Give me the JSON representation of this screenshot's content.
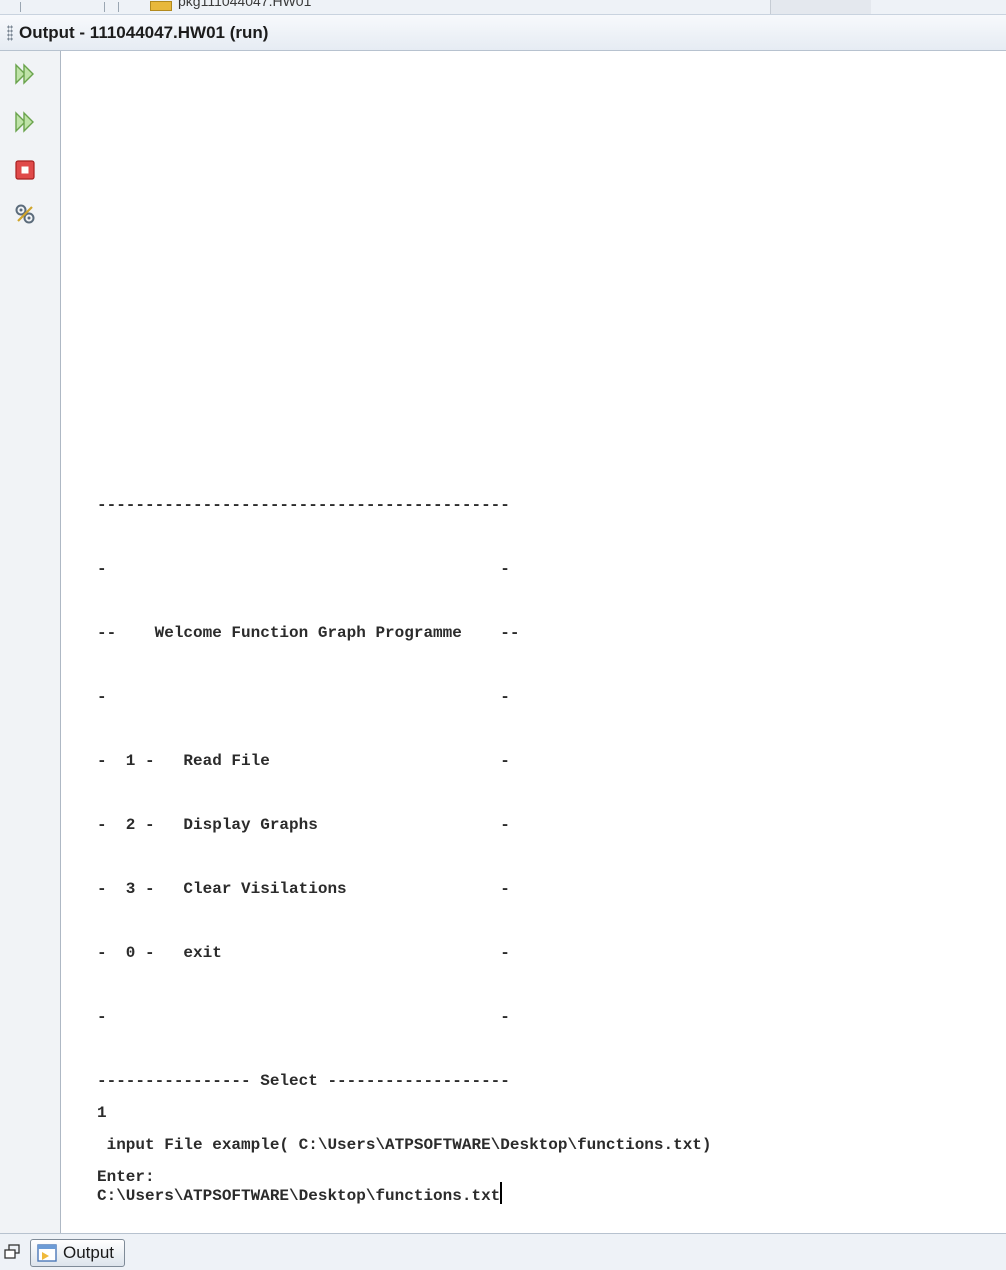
{
  "top_strip": {
    "tree_item": "pkg111044047.HW01"
  },
  "window": {
    "title": "Output - 111044047.HW01 (run)"
  },
  "toolbar": {
    "buttons": [
      {
        "icon": "rerun-icon"
      },
      {
        "icon": "rerun-with-options-icon"
      },
      {
        "icon": "stop-icon"
      },
      {
        "icon": "settings-icon"
      }
    ]
  },
  "console": {
    "lines": [
      "-------------------------------------------",
      "",
      "-                                         -",
      "",
      "--    Welcome Function Graph Programme    --",
      "",
      "-                                         -",
      "",
      "-  1 -   Read File                        -",
      "",
      "-  2 -   Display Graphs                   -",
      "",
      "-  3 -   Clear Visilations                -",
      "",
      "-  0 -   exit                             -",
      "",
      "-                                         -",
      "",
      "---------------- Select -------------------",
      "1",
      " input File example( C:\\Users\\ATPSOFTWARE\\Desktop\\functions.txt)",
      "Enter:"
    ],
    "input_value": "C:\\Users\\ATPSOFTWARE\\Desktop\\functions.txt"
  },
  "bottom": {
    "tab_label": "Output"
  }
}
